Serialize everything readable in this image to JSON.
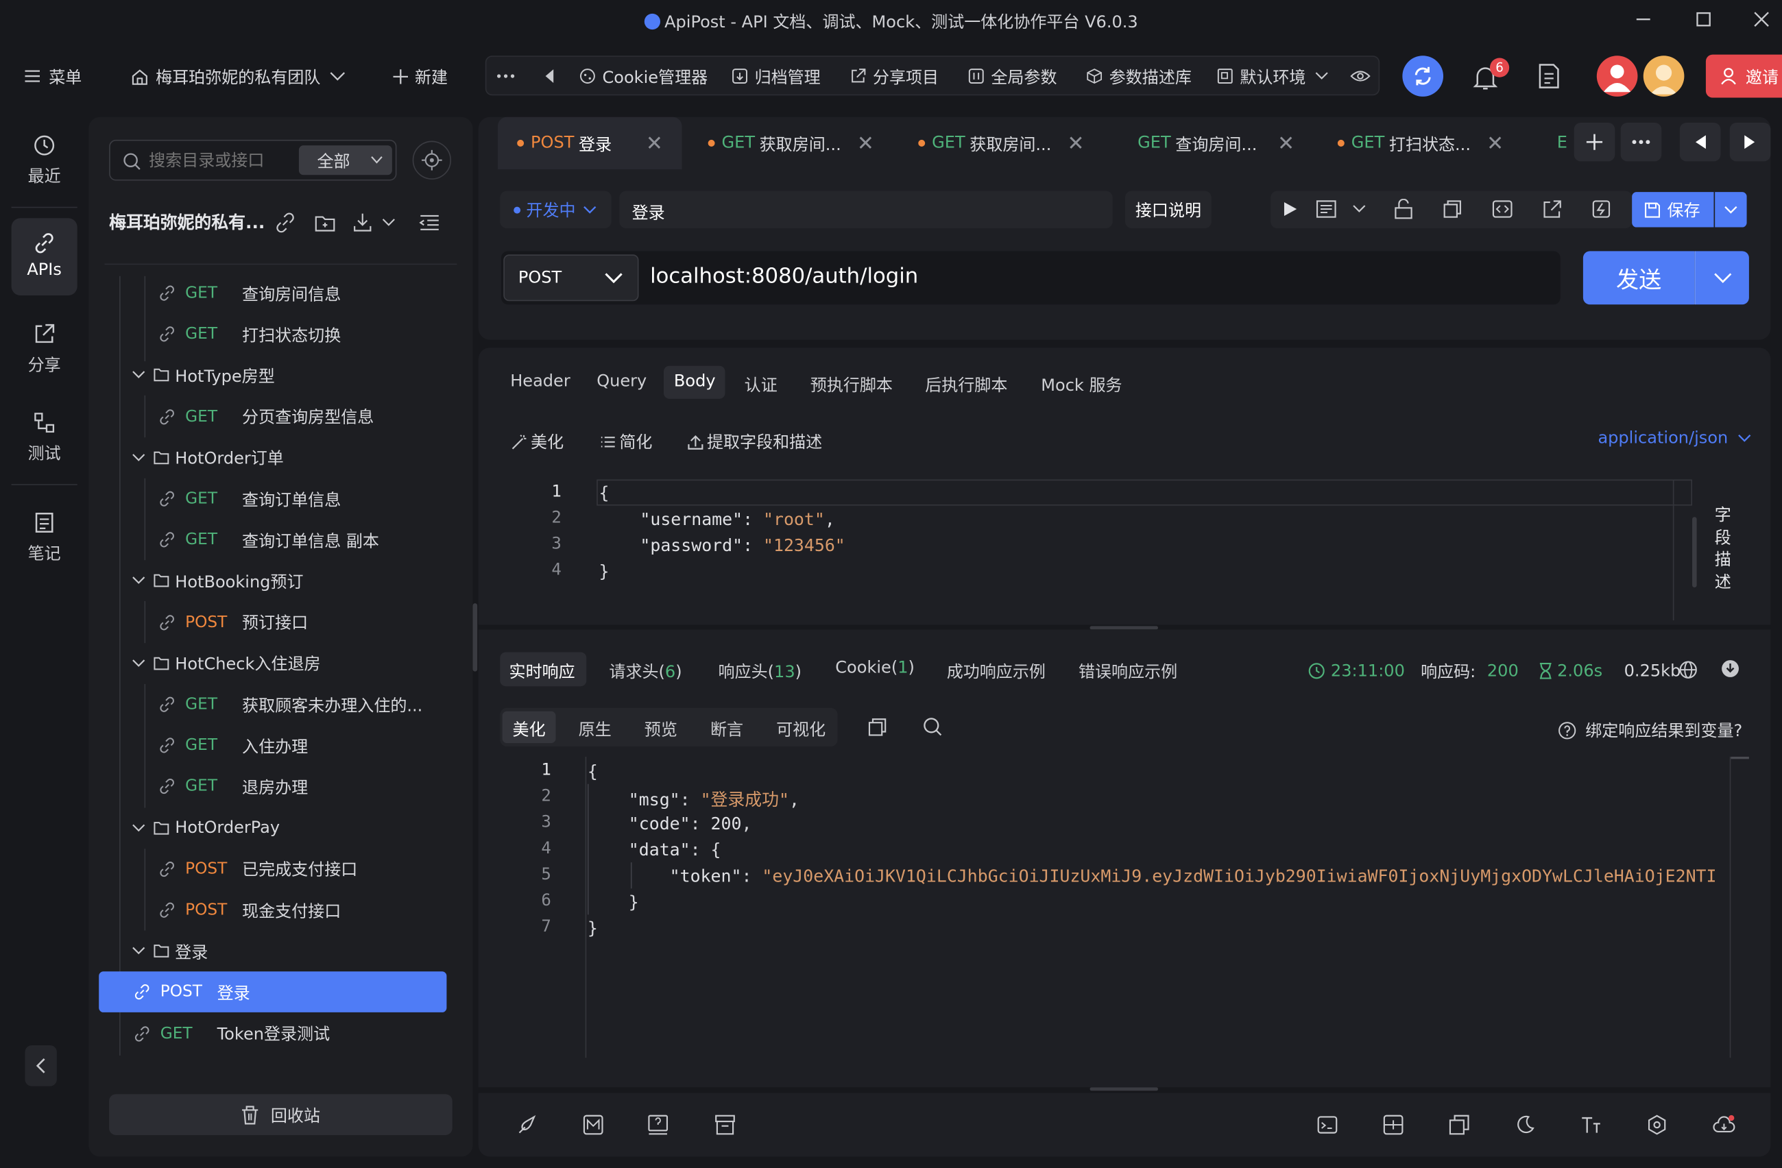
{
  "window": {
    "title": "ApiPost - API 文档、调试、Mock、测试一体化协作平台 V6.0.3"
  },
  "topbar": {
    "menu_label": "菜单",
    "team_label": "梅耳珀弥妮的私有团队",
    "new_label": "新建",
    "tools": [
      "Cookie管理器",
      "归档管理",
      "分享项目",
      "全局参数",
      "参数描述库",
      "默认环境"
    ],
    "notification_count": "6",
    "invite_label": "邀请"
  },
  "rail": {
    "items": [
      "最近",
      "APIs",
      "分享",
      "测试",
      "笔记"
    ]
  },
  "tree": {
    "search_placeholder": "搜索目录或接口",
    "filter_label": "全部",
    "project_title": "梅耳珀弥妮的私有...",
    "nodes": [
      {
        "type": "api",
        "method": "GET",
        "name": "查询房间信息"
      },
      {
        "type": "api",
        "method": "GET",
        "name": "打扫状态切换"
      },
      {
        "type": "folder",
        "name": "HotType房型"
      },
      {
        "type": "api",
        "method": "GET",
        "name": "分页查询房型信息"
      },
      {
        "type": "folder",
        "name": "HotOrder订单"
      },
      {
        "type": "api",
        "method": "GET",
        "name": "查询订单信息"
      },
      {
        "type": "api",
        "method": "GET",
        "name": "查询订单信息 副本"
      },
      {
        "type": "folder",
        "name": "HotBooking预订"
      },
      {
        "type": "api",
        "method": "POST",
        "name": "预订接口"
      },
      {
        "type": "folder",
        "name": "HotCheck入住退房"
      },
      {
        "type": "api",
        "method": "GET",
        "name": "获取顾客未办理入住的..."
      },
      {
        "type": "api",
        "method": "GET",
        "name": "入住办理"
      },
      {
        "type": "api",
        "method": "GET",
        "name": "退房办理"
      },
      {
        "type": "folder",
        "name": "HotOrderPay"
      },
      {
        "type": "api",
        "method": "POST",
        "name": "已完成支付接口"
      },
      {
        "type": "api",
        "method": "POST",
        "name": "现金支付接口"
      },
      {
        "type": "folder",
        "name": "登录"
      },
      {
        "type": "api",
        "method": "POST",
        "name": "登录",
        "selected": true
      },
      {
        "type": "api",
        "method": "GET",
        "name": "Token登录测试"
      }
    ],
    "recycle_label": "回收站"
  },
  "tabs": [
    {
      "method": "POST",
      "name": "登录"
    },
    {
      "method": "GET",
      "name": "获取房间..."
    },
    {
      "method": "GET",
      "name": "获取房间..."
    },
    {
      "method": "GET",
      "name": "查询房间..."
    },
    {
      "method": "GET",
      "name": "打扫状态..."
    },
    {
      "method": "E",
      "name": ""
    }
  ],
  "request": {
    "status_label": "开发中",
    "name": "登录",
    "doc_label": "接口说明",
    "save_label": "保存",
    "method": "POST",
    "url": "localhost:8080/auth/login",
    "send_label": "发送",
    "subtabs": [
      "Header",
      "Query",
      "Body",
      "认证",
      "预执行脚本",
      "后执行脚本",
      "Mock 服务"
    ],
    "active_subtab": "Body",
    "body_tools": [
      "美化",
      "简化",
      "提取字段和描述"
    ],
    "content_type": "application/json",
    "side_label": [
      "字",
      "段",
      "描",
      "述"
    ],
    "body_lines": [
      "1",
      "2",
      "3",
      "4"
    ],
    "body": {
      "username": "root",
      "password": "123456"
    }
  },
  "response": {
    "tabs": [
      {
        "label": "实时响应",
        "count": ""
      },
      {
        "label": "请求头(",
        "count": "6",
        "suffix": ")"
      },
      {
        "label": "响应头(",
        "count": "13",
        "suffix": ")"
      },
      {
        "label": "Cookie(",
        "count": "1",
        "suffix": ")"
      },
      {
        "label": "成功响应示例",
        "count": ""
      },
      {
        "label": "错误响应示例",
        "count": ""
      }
    ],
    "time": "23:11:00",
    "code_label": "响应码:",
    "code": "200",
    "duration": "2.06s",
    "size": "0.25kb",
    "view_modes": [
      "美化",
      "原生",
      "预览",
      "断言",
      "可视化"
    ],
    "bind_label": "绑定响应结果到变量?",
    "lines": [
      "1",
      "2",
      "3",
      "4",
      "5",
      "6",
      "7"
    ],
    "msg": "登录成功",
    "code_value": "200",
    "token": "eyJ0eXAiOiJKV1QiLCJhbGciOiJIUzUxMiJ9.eyJzdWIiOiJyb290IiwiaWF0IjoxNjUyMjgxODYwLCJleHAiOjE2NTI"
  },
  "colors": {
    "accent": "#4f7cf6",
    "get": "#4fb37a",
    "post": "#f0883e",
    "danger": "#e5484d"
  }
}
